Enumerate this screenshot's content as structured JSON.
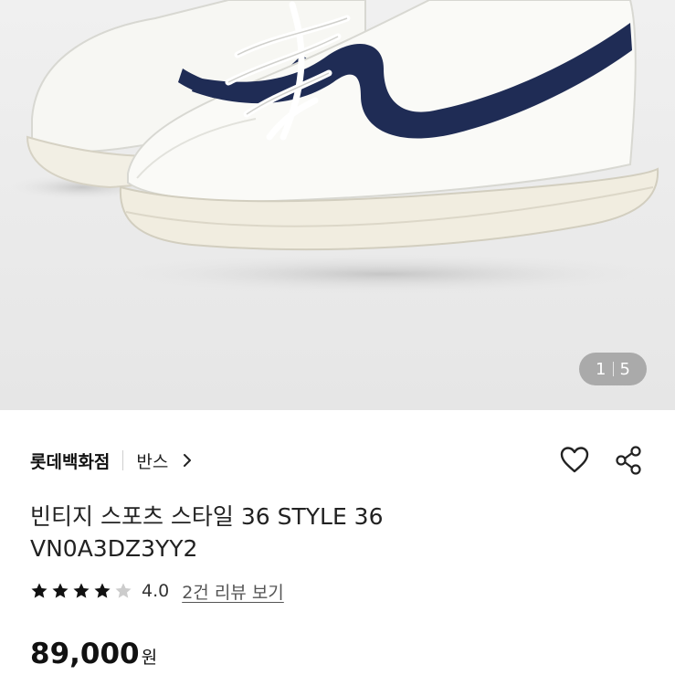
{
  "product_image": {
    "current": "1",
    "total": "5"
  },
  "store": {
    "brand": "롯데백화점",
    "shop": "반스"
  },
  "product": {
    "title": "빈티지 스포츠 스타일 36 STYLE 36 VN0A3DZ3YY2"
  },
  "rating": {
    "value": "4.0",
    "score": 4,
    "max": 5,
    "review_link": "2건 리뷰 보기"
  },
  "price": {
    "amount": "89,000",
    "unit": "원"
  },
  "icons": {
    "wishlist": "heart-icon",
    "share": "share-icon",
    "chevron": "chevron-right-icon"
  },
  "colors": {
    "stripe": "#1f2c55",
    "star_filled": "#111111",
    "star_empty": "#cccccc"
  }
}
